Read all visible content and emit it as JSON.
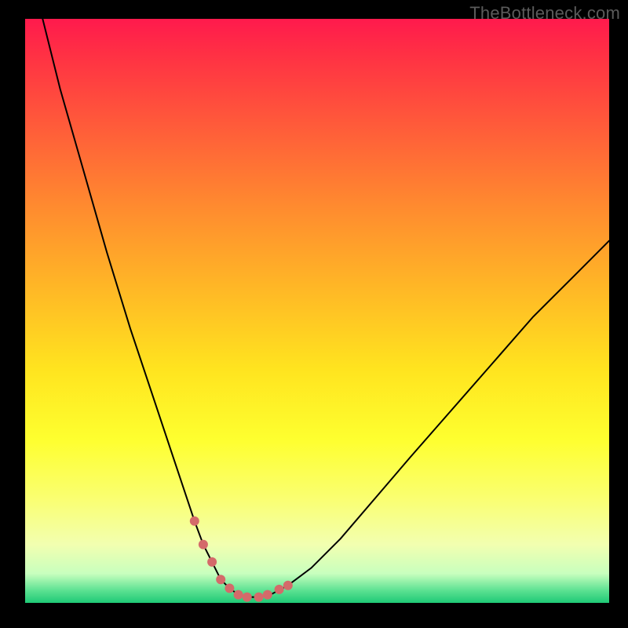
{
  "watermark": "TheBottleneck.com",
  "chart_data": {
    "type": "line",
    "title": "",
    "xlabel": "",
    "ylabel": "",
    "xlim": [
      0,
      100
    ],
    "ylim": [
      0,
      100
    ],
    "grid": false,
    "legend": false,
    "series": [
      {
        "name": "bottleneck-curve",
        "color": "#000000",
        "width": 2,
        "x": [
          3,
          6,
          10,
          14,
          18,
          22,
          25,
          27,
          29,
          30.5,
          32,
          33.5,
          35,
          36.5,
          38,
          40,
          42,
          45,
          49,
          54,
          60,
          66,
          73,
          80,
          87,
          94,
          100
        ],
        "y": [
          100,
          88,
          74,
          60,
          47,
          35,
          26,
          20,
          14,
          10,
          7,
          4,
          2.5,
          1.4,
          1,
          1,
          1.4,
          3,
          6,
          11,
          18,
          25,
          33,
          41,
          49,
          56,
          62
        ]
      },
      {
        "name": "optimal-markers",
        "color": "#d46a6a",
        "marker_radius": 6,
        "x": [
          29,
          30.5,
          32,
          33.5,
          35,
          36.5,
          38,
          40,
          41.5,
          43.5,
          45
        ],
        "y": [
          14,
          10,
          7,
          4,
          2.5,
          1.4,
          1,
          1,
          1.4,
          2.3,
          3
        ]
      }
    ],
    "gradient_stops": [
      {
        "pos": 0,
        "color": "#ff1a4d"
      },
      {
        "pos": 18,
        "color": "#ff5a3a"
      },
      {
        "pos": 46,
        "color": "#ffb726"
      },
      {
        "pos": 72,
        "color": "#feff2f"
      },
      {
        "pos": 90,
        "color": "#f2ffb0"
      },
      {
        "pos": 100,
        "color": "#1fc976"
      }
    ]
  }
}
